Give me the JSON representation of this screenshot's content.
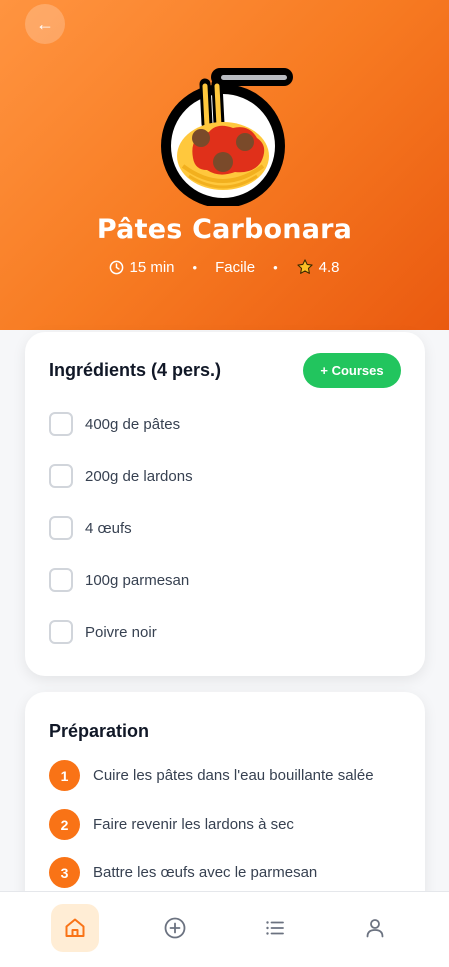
{
  "header": {
    "back_icon": "arrow-left-icon",
    "title": "Pâtes Carbonara",
    "meta": {
      "time": "15 min",
      "time_icon": "clock-icon",
      "difficulty": "Facile",
      "rating": "4.8",
      "rating_icon": "star-icon",
      "separator": "•"
    },
    "dish_icon": "spaghetti-icon"
  },
  "ingredients": {
    "title": "Ingrédients (4 pers.)",
    "courses_label": "+ Courses",
    "items": [
      {
        "label": "400g de pâtes",
        "checked": false
      },
      {
        "label": "200g de lardons",
        "checked": false
      },
      {
        "label": "4 œufs",
        "checked": false
      },
      {
        "label": "100g parmesan",
        "checked": false
      },
      {
        "label": "Poivre noir",
        "checked": false
      }
    ]
  },
  "preparation": {
    "title": "Préparation",
    "steps": [
      {
        "num": "1",
        "text": "Cuire les pâtes dans l'eau bouillante salée"
      },
      {
        "num": "2",
        "text": "Faire revenir les lardons à sec"
      },
      {
        "num": "3",
        "text": "Battre les œufs avec le parmesan"
      }
    ]
  },
  "nav": {
    "items": [
      {
        "icon": "home-icon",
        "active": true
      },
      {
        "icon": "plus-circle-icon",
        "active": false
      },
      {
        "icon": "list-icon",
        "active": false
      },
      {
        "icon": "user-icon",
        "active": false
      }
    ]
  },
  "colors": {
    "accent": "#f97316",
    "hero_start": "#ff9440",
    "hero_end": "#ea5a10",
    "green": "#22c55e",
    "nav_active_bg": "#ffedd5"
  }
}
